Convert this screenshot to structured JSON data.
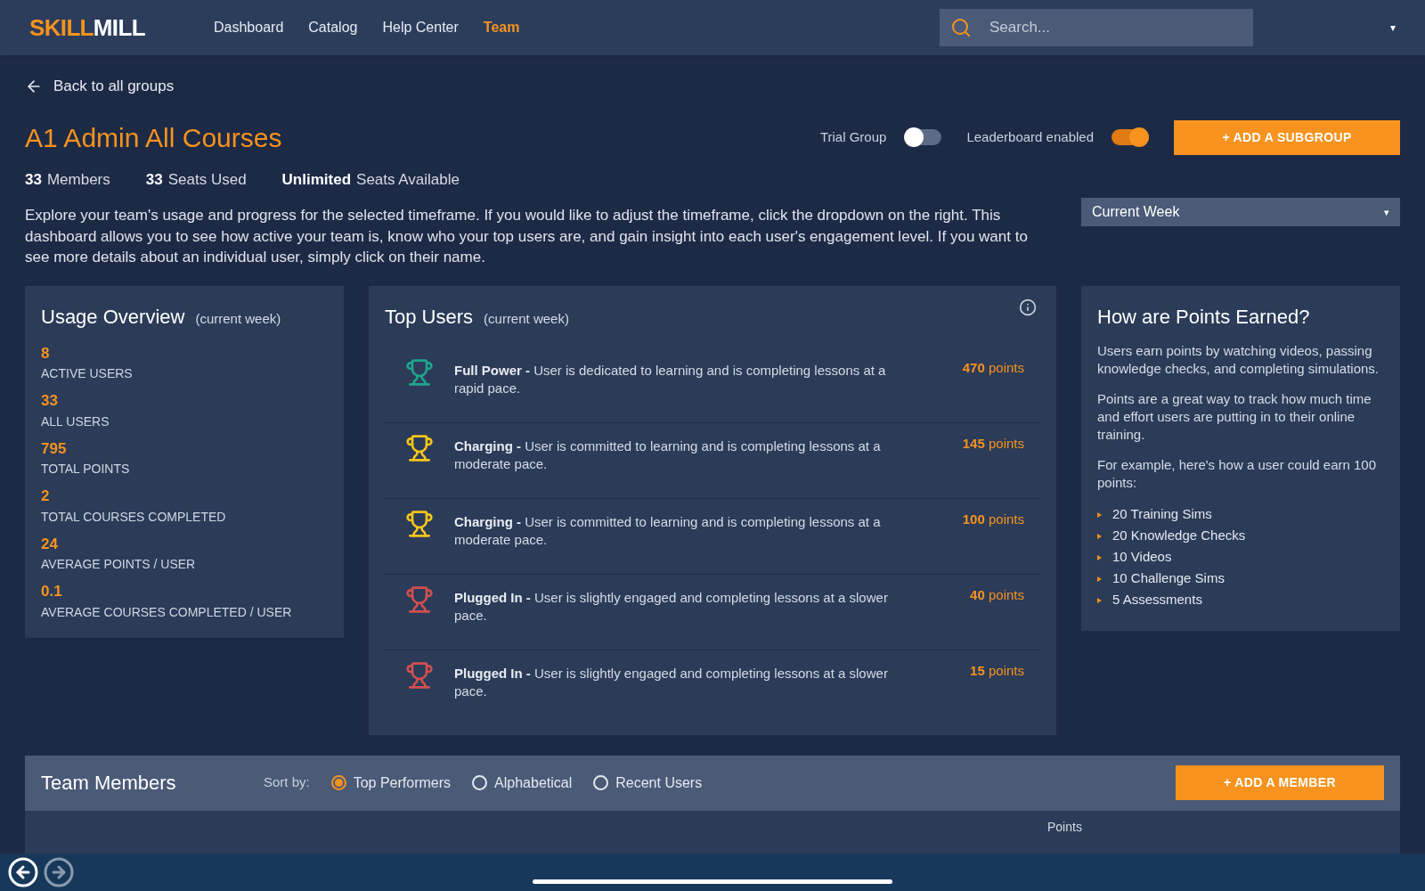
{
  "header": {
    "logo_left": "SKILL",
    "logo_right": "MILL",
    "nav": [
      {
        "label": "Dashboard",
        "selected": false
      },
      {
        "label": "Catalog",
        "selected": false
      },
      {
        "label": "Help Center",
        "selected": false
      },
      {
        "label": "Team",
        "selected": true
      }
    ],
    "search": {
      "placeholder": "Search..."
    },
    "menu_caret": "▾"
  },
  "back_link": "Back to all groups",
  "group": {
    "title": "A1 Admin All Courses",
    "stats": [
      {
        "value": "33",
        "label": "Members"
      },
      {
        "value": "33",
        "label": "Seats Used"
      },
      {
        "value": "Unlimited",
        "label": "Seats Available"
      }
    ],
    "toggles": [
      {
        "label": "Trial Group",
        "on": false
      },
      {
        "label": "Leaderboard enabled",
        "on": true
      }
    ],
    "add_subgroup": "+ ADD A SUBGROUP",
    "description": "Explore your team's usage and progress for the selected timeframe. If you would like to adjust the timeframe, click the dropdown on the right. This dashboard allows you to see how active your team is, know who your top users are, and gain insight into each user's engagement level. If you want to see more details about an individual user, simply click on their name.",
    "timeframe": {
      "value": "Current Week",
      "caret": "▾"
    }
  },
  "usage_overview": {
    "title": "Usage Overview",
    "subtitle": "(current week)",
    "metrics": [
      {
        "value": "8",
        "label": "ACTIVE USERS"
      },
      {
        "value": "33",
        "label": "ALL USERS"
      },
      {
        "value": "795",
        "label": "TOTAL POINTS"
      },
      {
        "value": "2",
        "label": "TOTAL COURSES COMPLETED"
      },
      {
        "value": "24",
        "label": "AVERAGE POINTS / USER"
      },
      {
        "value": "0.1",
        "label": "AVERAGE COURSES COMPLETED / USER"
      }
    ]
  },
  "top_users": {
    "title": "Top Users",
    "subtitle": "(current week)",
    "users": [
      {
        "level": "Full Power -",
        "text": "User is dedicated to learning and is completing lessons at a rapid pace.",
        "points": "470",
        "unit": "points",
        "color": "#1fa58a"
      },
      {
        "level": "Charging -",
        "text": "User is committed to learning and is completing lessons at a moderate pace.",
        "points": "145",
        "unit": "points",
        "color": "#f5c518"
      },
      {
        "level": "Charging -",
        "text": "User is committed to learning and is completing lessons at a moderate pace.",
        "points": "100",
        "unit": "points",
        "color": "#f5c518"
      },
      {
        "level": "Plugged In -",
        "text": "User is slightly engaged and completing lessons at a slower pace.",
        "points": "40",
        "unit": "points",
        "color": "#d0504f"
      },
      {
        "level": "Plugged In -",
        "text": "User is slightly engaged and completing lessons at a slower pace.",
        "points": "15",
        "unit": "points",
        "color": "#d0504f"
      }
    ]
  },
  "points_info": {
    "title": "How are Points Earned?",
    "paragraphs": [
      "Users earn points by watching videos, passing knowledge checks, and completing simulations.",
      "Points are a great way to track how much time and effort users are putting in to their online training.",
      "For example, here's how a user could earn 100 points:"
    ],
    "bullets": [
      "20 Training Sims",
      "20 Knowledge Checks",
      "10 Videos",
      "10 Challenge Sims",
      "5 Assessments"
    ]
  },
  "team_members": {
    "title": "Team Members",
    "sort_label": "Sort by:",
    "sort_options": [
      {
        "label": "Top Performers",
        "selected": true
      },
      {
        "label": "Alphabetical",
        "selected": false
      },
      {
        "label": "Recent Users",
        "selected": false
      }
    ],
    "add_member": "+ ADD A MEMBER",
    "columns": [
      "Points"
    ]
  }
}
